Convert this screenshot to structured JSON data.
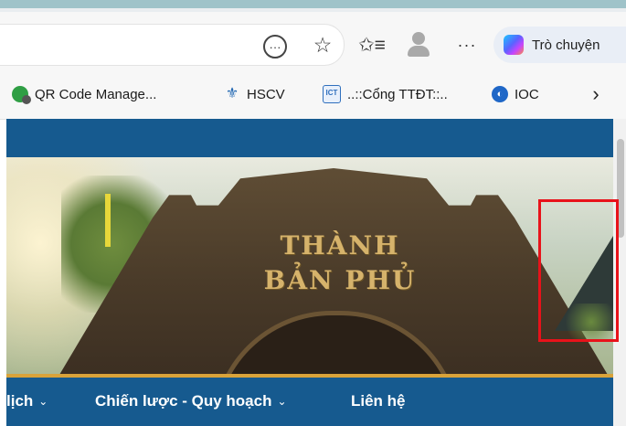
{
  "browser": {
    "copilot_label": "Trò chuyện",
    "icons": {
      "read_aloud": "more-circle-icon",
      "favorite": "star-icon",
      "favorites": "favorites-list-icon",
      "profile": "profile-avatar-icon",
      "more": "more-icon",
      "copilot": "copilot-icon"
    }
  },
  "favorites_bar": {
    "items": [
      {
        "label": "QR Code Manage...",
        "icon": "qr-code-manager-icon"
      },
      {
        "label": "HSCV",
        "icon": "hscv-icon"
      },
      {
        "label": "..::Cổng TTĐT::..",
        "icon": "ict-icon"
      },
      {
        "label": "IOC",
        "icon": "ioc-icon"
      }
    ],
    "overflow_icon": "chevron-right-icon"
  },
  "hero": {
    "gate_text_line1": "THÀNH",
    "gate_text_line2": "BẢN PHỦ"
  },
  "annotation": {
    "color": "#e8121a"
  },
  "nav": {
    "items": [
      {
        "label": "lịch",
        "has_dropdown": true
      },
      {
        "label": "Chiến lược - Quy hoạch",
        "has_dropdown": true
      },
      {
        "label": "Liên hệ",
        "has_dropdown": false
      }
    ],
    "background": "#165a8f",
    "accent": "#d9a33a"
  }
}
